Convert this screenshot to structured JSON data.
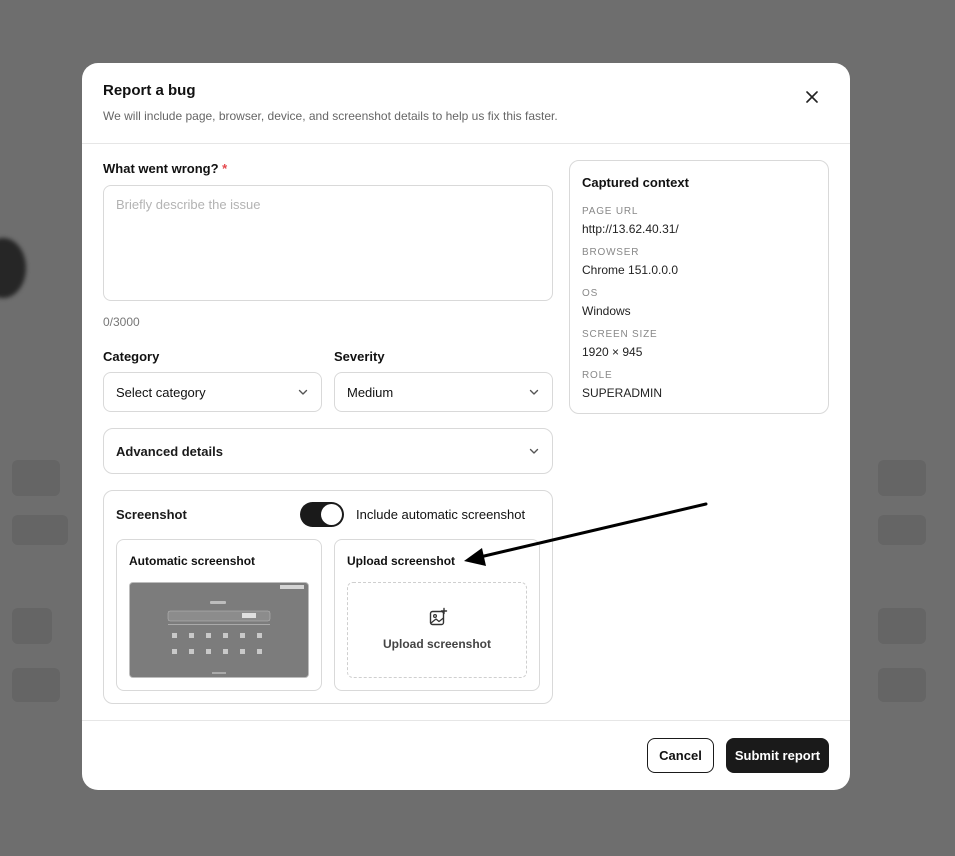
{
  "modal": {
    "title": "Report a bug",
    "subtitle": "We will include page, browser, device, and screenshot details to help us fix this faster."
  },
  "description": {
    "label": "What went wrong?",
    "required_mark": "*",
    "placeholder": "Briefly describe the issue",
    "value": "",
    "char_count": "0/3000"
  },
  "category": {
    "label": "Category",
    "value": "Select category"
  },
  "severity": {
    "label": "Severity",
    "value": "Medium"
  },
  "advanced": {
    "label": "Advanced details"
  },
  "screenshot": {
    "title": "Screenshot",
    "toggle_label": "Include automatic screenshot",
    "toggle_on": true,
    "auto_title": "Automatic screenshot",
    "upload_title": "Upload screenshot",
    "upload_button": "Upload screenshot"
  },
  "context": {
    "title": "Captured context",
    "items": [
      {
        "key": "PAGE URL",
        "value": "http://13.62.40.31/"
      },
      {
        "key": "BROWSER",
        "value": "Chrome 151.0.0.0"
      },
      {
        "key": "OS",
        "value": "Windows"
      },
      {
        "key": "SCREEN SIZE",
        "value": "1920 × 945"
      },
      {
        "key": "ROLE",
        "value": "SUPERADMIN"
      }
    ]
  },
  "footer": {
    "cancel_label": "Cancel",
    "submit_label": "Submit report"
  },
  "icons": {
    "close": "close-icon",
    "chevron": "chevron-down-icon",
    "upload": "image-plus-icon"
  },
  "colors": {
    "primary": "#1a1a1a",
    "required": "#e5484d",
    "overlay": "#6e6e6e"
  }
}
